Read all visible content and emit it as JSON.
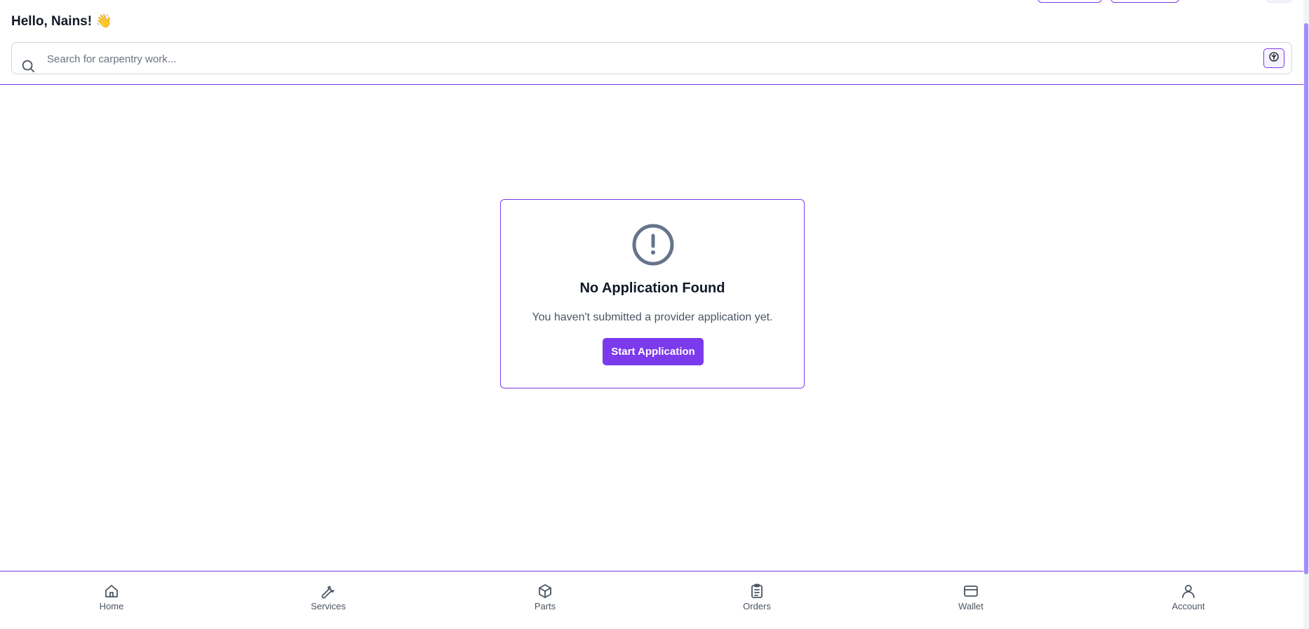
{
  "header": {
    "greeting": "Hello, Nains! 👋"
  },
  "search": {
    "placeholder": "Search for carpentry work...",
    "value": "",
    "icon": "search-icon",
    "filter_icon": "filter-icon"
  },
  "empty_state": {
    "icon": "alert-circle-icon",
    "title": "No Application Found",
    "description": "You haven't submitted a provider application yet.",
    "button_label": "Start Application"
  },
  "nav": {
    "items": [
      {
        "label": "Home",
        "icon": "home-icon"
      },
      {
        "label": "Services",
        "icon": "wrench-icon"
      },
      {
        "label": "Parts",
        "icon": "package-icon"
      },
      {
        "label": "Orders",
        "icon": "clipboard-list-icon"
      },
      {
        "label": "Wallet",
        "icon": "credit-card-icon"
      },
      {
        "label": "Account",
        "icon": "user-icon"
      }
    ]
  },
  "colors": {
    "accent": "#7c3aed",
    "icon_gray": "#64748b",
    "text_muted": "#4b5563"
  }
}
